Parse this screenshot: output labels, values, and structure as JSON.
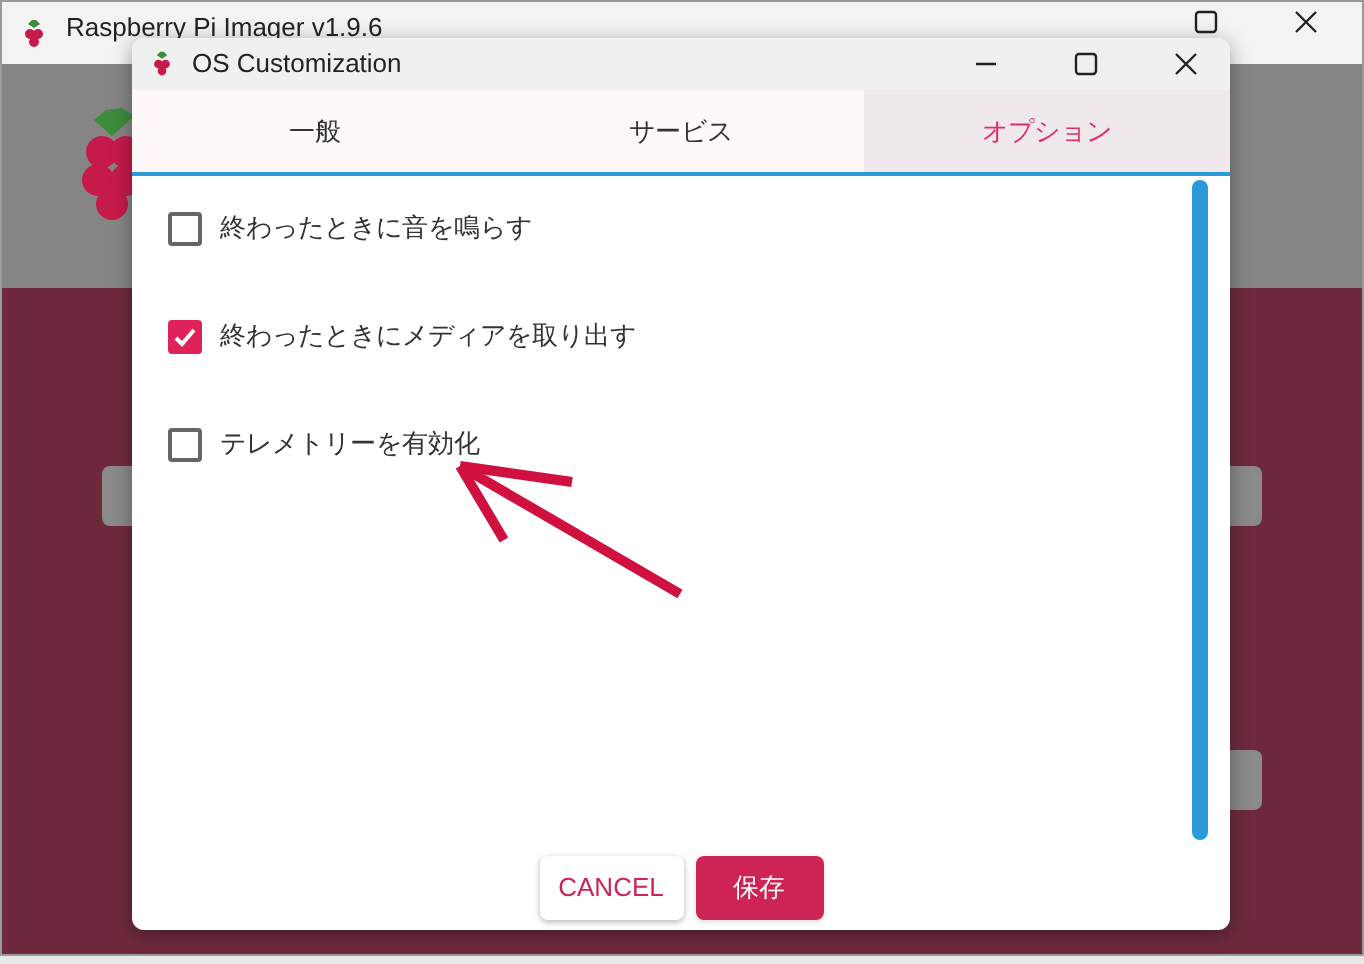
{
  "background_window": {
    "title": "Raspberry Pi Imager v1.9.6"
  },
  "dialog": {
    "title": "OS Customization",
    "tabs": [
      {
        "label": "一般",
        "selected": false
      },
      {
        "label": "サービス",
        "selected": false
      },
      {
        "label": "オプション",
        "selected": true
      }
    ],
    "options": [
      {
        "label": "終わったときに音を鳴らす",
        "checked": false
      },
      {
        "label": "終わったときにメディアを取り出す",
        "checked": true
      },
      {
        "label": "テレメトリーを有効化",
        "checked": false
      }
    ],
    "buttons": [
      {
        "label": "CANCEL",
        "kind": "secondary"
      },
      {
        "label": "保存",
        "kind": "primary"
      }
    ]
  }
}
